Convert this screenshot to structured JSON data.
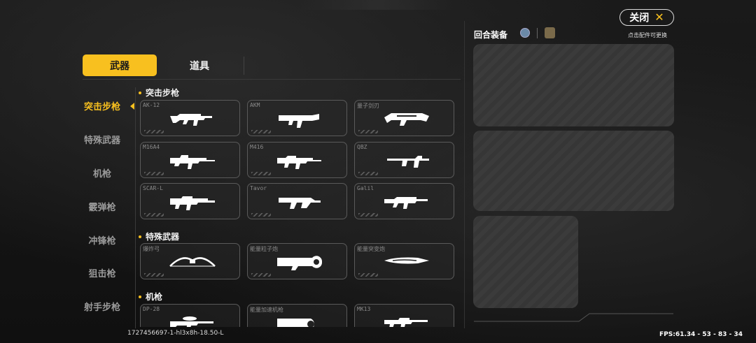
{
  "tabs": {
    "weapons": "武器",
    "items": "道具"
  },
  "categories": [
    "突击步枪",
    "特殊武器",
    "机枪",
    "霰弹枪",
    "冲锋枪",
    "狙击枪",
    "射手步枪"
  ],
  "sections": [
    {
      "title": "突击步枪",
      "cards": [
        "AK-12",
        "AKM",
        "量子剑刃",
        "M16A4",
        "M416",
        "QBZ",
        "SCAR-L",
        "Tavor",
        "Galil"
      ]
    },
    {
      "title": "特殊武器",
      "cards": [
        "爆炸弓",
        "能量粒子炮",
        "能量突变炮"
      ]
    },
    {
      "title": "机枪",
      "cards": [
        "DP-28",
        "能量加速机枪",
        "MK13"
      ]
    }
  ],
  "right": {
    "close_label": "关闭",
    "close_icon": "close-icon",
    "round_title": "回合装备",
    "hint": "点击配件可更换"
  },
  "footer": {
    "build": "1727456697-1-hl3x8h-18.50-L",
    "fps": "FPS:61.34 - 53 - 83 - 34"
  },
  "colors": {
    "accent": "#f8c01f",
    "panel": "#3b3b3b"
  }
}
